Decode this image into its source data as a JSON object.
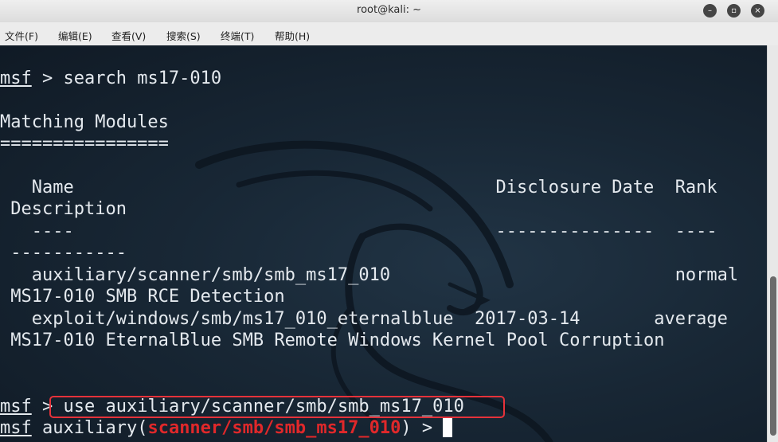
{
  "window": {
    "title": "root@kali: ~"
  },
  "window_controls": {
    "minimize": "–",
    "maximize": "▫",
    "close": "×"
  },
  "menu": [
    "文件(F)",
    "编辑(E)",
    "查看(V)",
    "搜索(S)",
    "终端(T)",
    "帮助(H)"
  ],
  "terminal": {
    "prompt": "msf",
    "cmd1": " > search ms17-010",
    "matching": "Matching Modules",
    "separator": "================",
    "header1": "   Name                                        Disclosure Date  Rank",
    "header2": " Description",
    "dash1": "   ----                                        ---------------  ----",
    "dash2": " -----------",
    "rows": [
      {
        "line1": "   auxiliary/scanner/smb/smb_ms17_010                           normal",
        "line2": " MS17-010 SMB RCE Detection"
      },
      {
        "line1": "   exploit/windows/smb/ms17_010_eternalblue  2017-03-14       average",
        "line2": " MS17-010 EternalBlue SMB Remote Windows Kernel Pool Corruption"
      }
    ],
    "cmd2_prefix": " > ",
    "cmd2": "use auxiliary/scanner/smb/smb_ms17_010",
    "module_prefix": " auxiliary(",
    "module": "scanner/smb/smb_ms17_010",
    "module_suffix": ") > "
  },
  "colors": {
    "background": "#14202b",
    "text": "#e4e9ee",
    "highlight": "#e6323a",
    "module": "#e0282a"
  }
}
